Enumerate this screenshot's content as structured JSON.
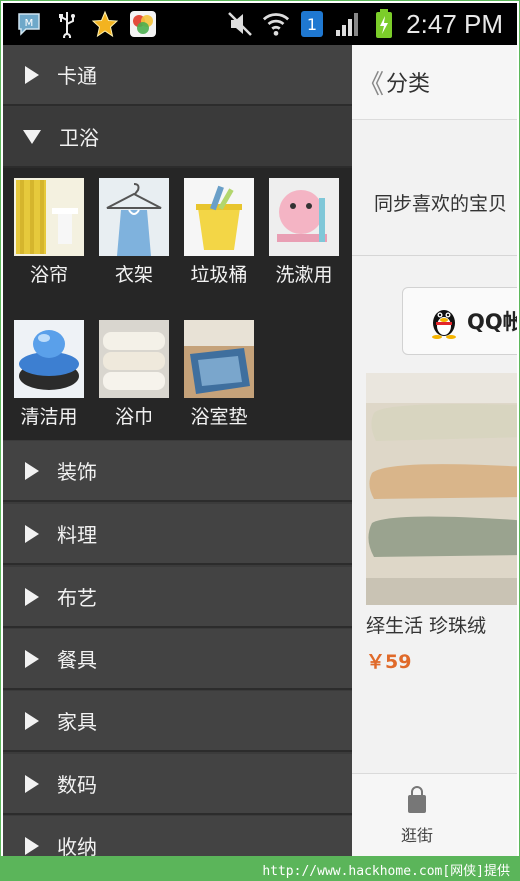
{
  "status_bar": {
    "time": "2:47 PM",
    "sim_badge": "1",
    "icons": [
      "messenger-icon",
      "usb-icon",
      "star-icon",
      "app-icon",
      "mute-icon",
      "wifi-icon",
      "sim-icon",
      "signal-icon",
      "battery-icon"
    ]
  },
  "header": {
    "back_glyph": "《",
    "title": "分类"
  },
  "main": {
    "sync_text": "同步喜欢的宝贝",
    "qq_button_label": "QQ帐",
    "product": {
      "title": "绎生活 珍珠绒 ",
      "price": "￥59"
    },
    "bottom_nav": {
      "label": "逛街"
    }
  },
  "drawer": {
    "categories": [
      {
        "label": "卡通",
        "expanded": false
      },
      {
        "label": "卫浴",
        "expanded": true
      },
      {
        "label": "装饰",
        "expanded": false
      },
      {
        "label": "料理",
        "expanded": false
      },
      {
        "label": "布艺",
        "expanded": false
      },
      {
        "label": "餐具",
        "expanded": false
      },
      {
        "label": "家具",
        "expanded": false
      },
      {
        "label": "数码",
        "expanded": false
      },
      {
        "label": "收纳",
        "expanded": false
      }
    ],
    "subcategories": [
      {
        "label": "浴帘"
      },
      {
        "label": "衣架"
      },
      {
        "label": "垃圾桶"
      },
      {
        "label": "洗漱用"
      },
      {
        "label": "清洁用"
      },
      {
        "label": "浴巾"
      },
      {
        "label": "浴室垫"
      }
    ]
  },
  "footer": {
    "text": "http://www.hackhome.com[网侠]提供"
  },
  "colors": {
    "drawer_bg": "#434343",
    "subpanel_bg": "#262626",
    "price": "#e06a2a",
    "watermark_green": "#5bb55a"
  }
}
